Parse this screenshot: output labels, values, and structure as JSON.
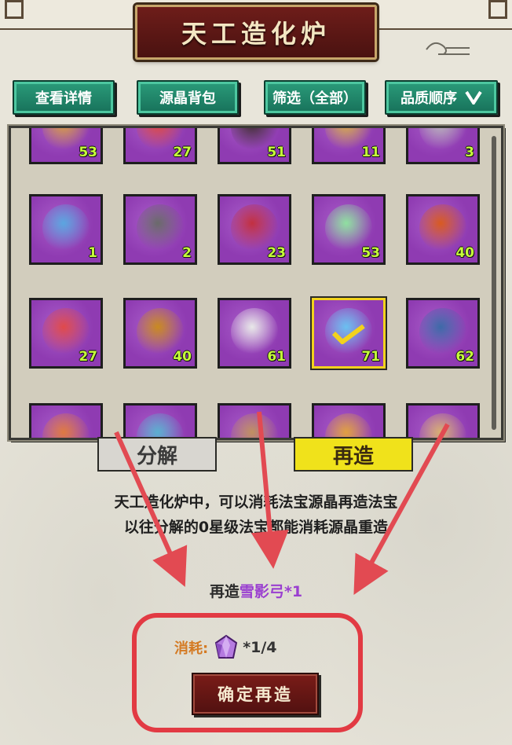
{
  "title": "天工造化炉",
  "tabs": [
    {
      "label": "查看详情"
    },
    {
      "label": "源晶背包"
    },
    {
      "label": "筛选（全部）"
    },
    {
      "label": "品质顺序"
    }
  ],
  "grid": {
    "rows": [
      [
        {
          "item": "golden-gauntlet",
          "count": "53"
        },
        {
          "item": "red-flame-relic",
          "count": "27"
        },
        {
          "item": "dark-horn-relic",
          "count": "51"
        },
        {
          "item": "golden-ring",
          "count": "11"
        },
        {
          "item": "silver-ring",
          "count": "3"
        }
      ],
      [
        {
          "item": "ice-dragon-bracelet",
          "count": "1"
        },
        {
          "item": "ruby-iron-ring",
          "count": "2"
        },
        {
          "item": "shadow-blade",
          "count": "23"
        },
        {
          "item": "jade-fan",
          "count": "53"
        },
        {
          "item": "flame-axe",
          "count": "40"
        }
      ],
      [
        {
          "item": "crimson-talisman",
          "count": "27"
        },
        {
          "item": "lion-helm",
          "count": "40"
        },
        {
          "item": "white-robe",
          "count": "61"
        },
        {
          "item": "snow-shadow-bow",
          "count": "71",
          "selected": true
        },
        {
          "item": "blue-armor",
          "count": "62"
        }
      ],
      [
        {
          "item": "partial-relic-1",
          "count": ""
        },
        {
          "item": "partial-relic-2",
          "count": ""
        },
        {
          "item": "partial-relic-3",
          "count": ""
        },
        {
          "item": "partial-relic-4",
          "count": ""
        },
        {
          "item": "partial-relic-5",
          "count": ""
        }
      ]
    ]
  },
  "sub_tabs": {
    "decompose": "分解",
    "reforge": "再造"
  },
  "description": {
    "line1": "天工造化炉中，可以消耗法宝源晶再造法宝",
    "line2": "以往分解的0星级法宝都能消耗源晶重造"
  },
  "reforge": {
    "prefix": "再造",
    "item_name": "雪影弓",
    "suffix": "*1"
  },
  "cost": {
    "label": "消耗:",
    "icon": "crystal-icon",
    "value": "*1/4"
  },
  "confirm_label": "确定再造",
  "colors": {
    "cell_purple": "#8f3bb2",
    "tab_green": "#1f8a6b",
    "count_green": "#c6ff3a",
    "reforge_tab_yellow": "#f0e21b",
    "confirm_red": "#6b1715",
    "annotation_red": "#e23a43",
    "item_name_purple": "#9a3fd0"
  }
}
